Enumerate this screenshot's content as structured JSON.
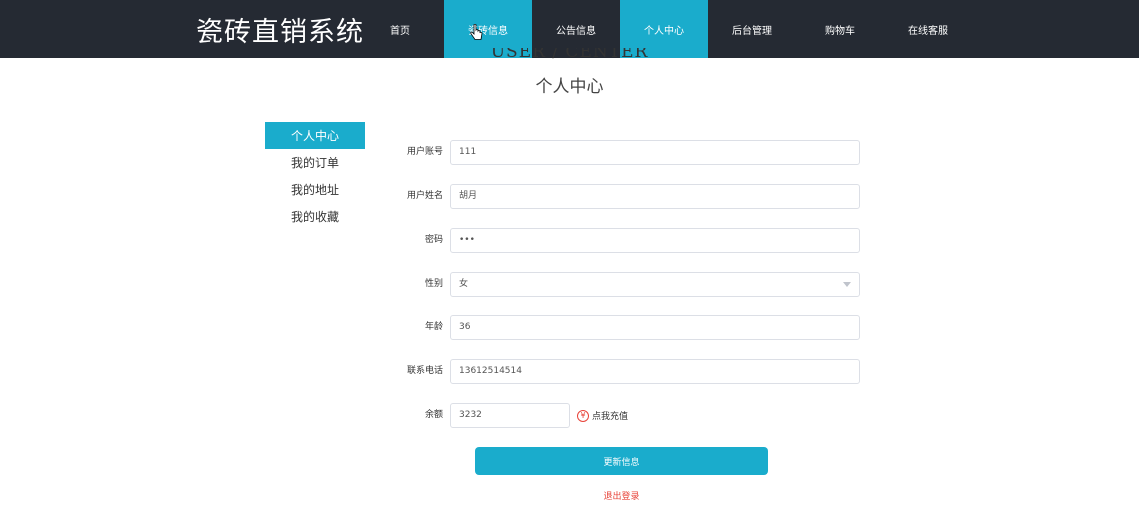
{
  "header": {
    "brand": "瓷砖直销系统",
    "nav": [
      {
        "label": "首页"
      },
      {
        "label": "瓷砖信息"
      },
      {
        "label": "公告信息"
      },
      {
        "label": "个人中心"
      },
      {
        "label": "后台管理"
      },
      {
        "label": "购物车"
      },
      {
        "label": "在线客服"
      }
    ],
    "active_colors": {
      "accent": "#1aaccc",
      "bar": "#252a33"
    }
  },
  "page": {
    "title_en": "USER / CENTER",
    "title_cn": "个人中心"
  },
  "sidebar": {
    "items": [
      {
        "label": "个人中心"
      },
      {
        "label": "我的订单"
      },
      {
        "label": "我的地址"
      },
      {
        "label": "我的收藏"
      }
    ]
  },
  "form": {
    "account": {
      "label": "用户账号",
      "value": "111"
    },
    "name": {
      "label": "用户姓名",
      "value": "胡月"
    },
    "password": {
      "label": "密码",
      "value": "•••"
    },
    "gender": {
      "label": "性别",
      "value": "女"
    },
    "age": {
      "label": "年龄",
      "value": "36"
    },
    "phone": {
      "label": "联系电话",
      "value": "13612514514"
    },
    "balance": {
      "label": "余额",
      "value": "3232"
    },
    "recharge_label": "点我充值",
    "yen_symbol": "¥"
  },
  "actions": {
    "update_label": "更新信息",
    "logout_label": "退出登录"
  }
}
